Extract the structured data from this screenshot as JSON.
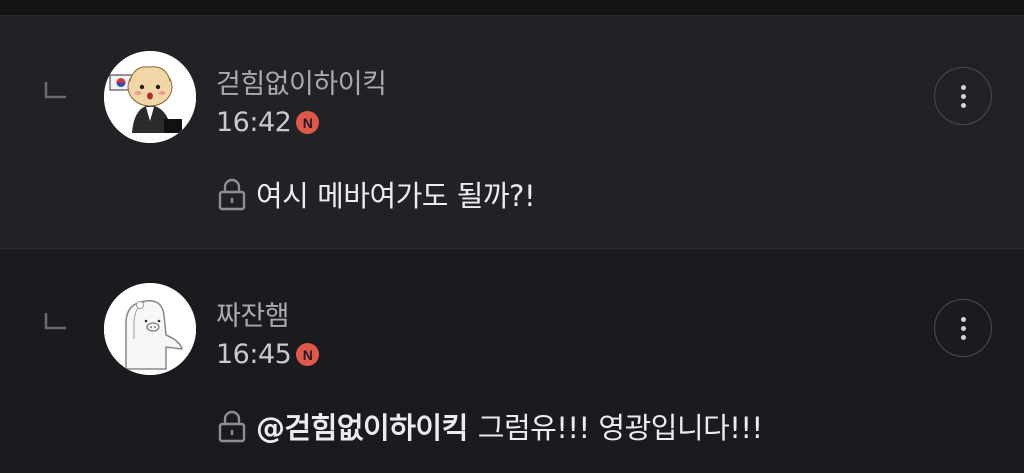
{
  "comments": [
    {
      "nickname": "걷힘없이하이킥",
      "time": "16:42",
      "badge": "N",
      "secret": true,
      "text": "여시 메바여가도 될까?!"
    },
    {
      "nickname": "짜잔햄",
      "time": "16:45",
      "badge": "N",
      "secret": true,
      "mention": "@걷힘없이하이킥",
      "text": "그럼유!!! 영광입니다!!!"
    }
  ],
  "icons": {
    "reply_marker": "reply-arrow-icon",
    "lock": "lock-icon",
    "more": "more-vertical-icon"
  },
  "colors": {
    "background": "#1c1c20",
    "new_badge": "#e0584a"
  }
}
